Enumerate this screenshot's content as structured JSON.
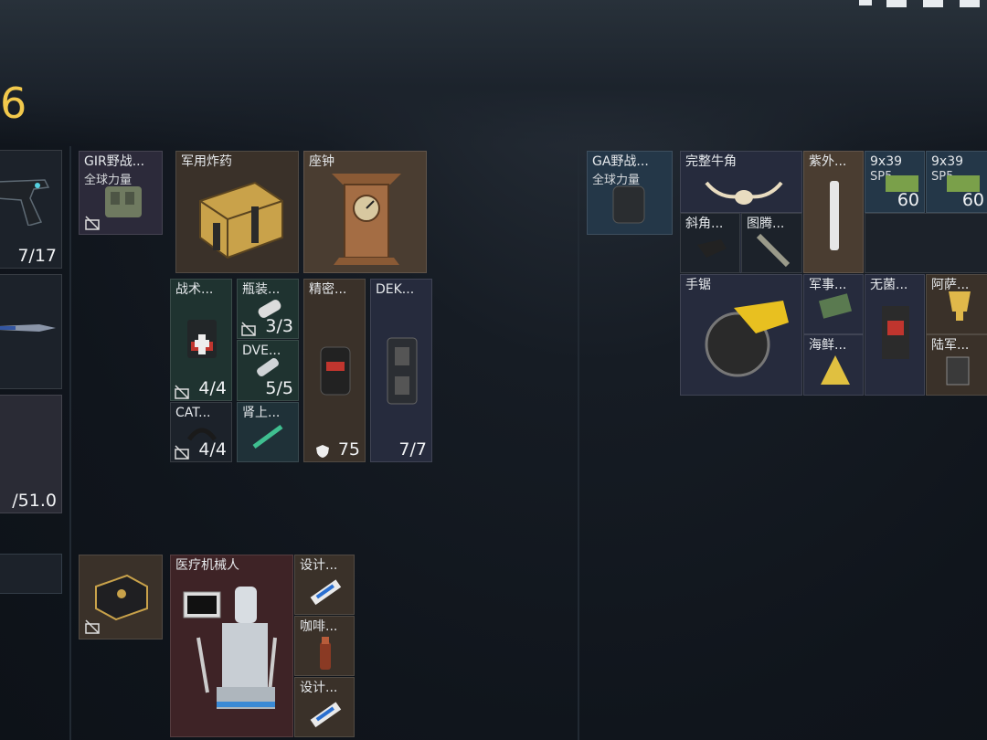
{
  "header": {
    "number": "6"
  },
  "left_column": {
    "pistol_count": "7/17",
    "weight": "/51.0"
  },
  "inventory": {
    "gir_case": {
      "label": "GIR野战...",
      "sub": "全球力量"
    },
    "explosive": {
      "label": "军用炸药"
    },
    "clock": {
      "label": "座钟"
    },
    "tactical": {
      "label": "战术...",
      "count": "4/4"
    },
    "bottle": {
      "label": "瓶装...",
      "count": "3/3"
    },
    "dve": {
      "label": "DVE...",
      "count": "5/5"
    },
    "cat": {
      "label": "CAT...",
      "count": "4/4"
    },
    "adrenaline": {
      "label": "肾上..."
    },
    "precision": {
      "label": "精密...",
      "count": "75"
    },
    "dek": {
      "label": "DEK...",
      "count": "7/7"
    },
    "robot": {
      "label": "医疗机械人"
    },
    "design1": {
      "label": "设计..."
    },
    "coffee": {
      "label": "咖啡..."
    },
    "design2": {
      "label": "设计..."
    }
  },
  "stash": {
    "ga_case": {
      "label": "GA野战...",
      "sub": "全球力量"
    },
    "horn": {
      "label": "完整牛角"
    },
    "uv": {
      "label": "紫外..."
    },
    "ammo1": {
      "label": "9x39",
      "sub": "SP5",
      "count": "60"
    },
    "ammo2": {
      "label": "9x39",
      "sub": "SP5",
      "count": "60"
    },
    "bevel": {
      "label": "斜角..."
    },
    "totem": {
      "label": "图腾..."
    },
    "saw": {
      "label": "手锯"
    },
    "military1": {
      "label": "军事..."
    },
    "sterile": {
      "label": "无菌..."
    },
    "alfa": {
      "label": "阿萨..."
    },
    "seafood": {
      "label": "海鲜..."
    },
    "army": {
      "label": "陆军..."
    }
  },
  "colors": {
    "accent_yellow": "#f2c94c",
    "rarity_brown": "#3a3129",
    "rarity_green": "#1f3330",
    "rarity_red": "#3e2326",
    "rarity_navy": "#262b3d"
  }
}
